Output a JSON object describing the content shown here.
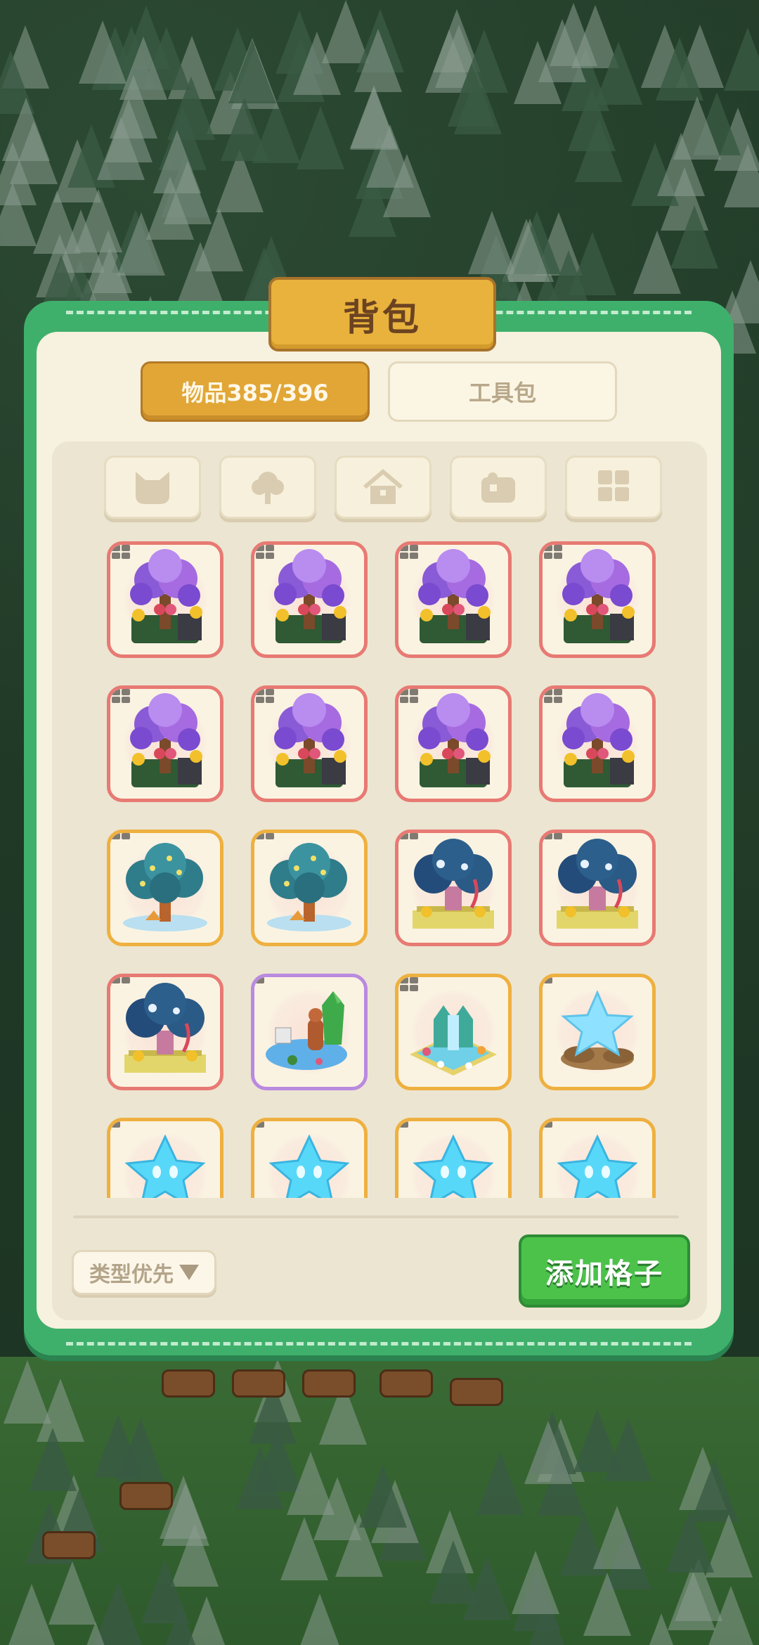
{
  "panel": {
    "title": "背包"
  },
  "tabs": [
    {
      "label": "物品385/396",
      "active": true
    },
    {
      "label": "工具包",
      "active": false
    }
  ],
  "categories": [
    {
      "icon": "cat-face-icon"
    },
    {
      "icon": "tree-icon"
    },
    {
      "icon": "house-icon"
    },
    {
      "icon": "puzzle-chest-icon"
    },
    {
      "icon": "grid-icon"
    }
  ],
  "items": [
    {
      "kind": "blossom-tree",
      "rarity": "red",
      "badge": 4
    },
    {
      "kind": "blossom-tree",
      "rarity": "red",
      "badge": 4
    },
    {
      "kind": "blossom-tree",
      "rarity": "red",
      "badge": 4
    },
    {
      "kind": "blossom-tree",
      "rarity": "red",
      "badge": 4
    },
    {
      "kind": "blossom-tree",
      "rarity": "red",
      "badge": 4
    },
    {
      "kind": "blossom-tree",
      "rarity": "red",
      "badge": 4
    },
    {
      "kind": "blossom-tree",
      "rarity": "red",
      "badge": 4
    },
    {
      "kind": "blossom-tree",
      "rarity": "red",
      "badge": 4
    },
    {
      "kind": "blue-tree",
      "rarity": "gold",
      "badge": 2
    },
    {
      "kind": "blue-tree",
      "rarity": "gold",
      "badge": 2
    },
    {
      "kind": "shrine-tree",
      "rarity": "red",
      "badge": 2
    },
    {
      "kind": "shrine-tree",
      "rarity": "red",
      "badge": 2
    },
    {
      "kind": "shrine-tree",
      "rarity": "red",
      "badge": 2
    },
    {
      "kind": "pond-garden",
      "rarity": "purple",
      "badge": 1
    },
    {
      "kind": "waterfall-garden",
      "rarity": "gold",
      "badge": 4
    },
    {
      "kind": "star-rock",
      "rarity": "gold",
      "badge": 1
    },
    {
      "kind": "star-plant",
      "rarity": "gold",
      "badge": 1
    },
    {
      "kind": "star-plant",
      "rarity": "gold",
      "badge": 1
    },
    {
      "kind": "star-plant",
      "rarity": "gold",
      "badge": 1
    },
    {
      "kind": "star-plant",
      "rarity": "gold",
      "badge": 1
    }
  ],
  "footer": {
    "sort_label": "类型优先",
    "add_label": "添加格子"
  },
  "colors": {
    "panel_green": "#3fb06b",
    "title_gold": "#e8b23d",
    "rarity_red": "#e77a73",
    "rarity_gold": "#eeb03f",
    "rarity_purple": "#b98ae0",
    "add_button": "#4cc24b"
  }
}
